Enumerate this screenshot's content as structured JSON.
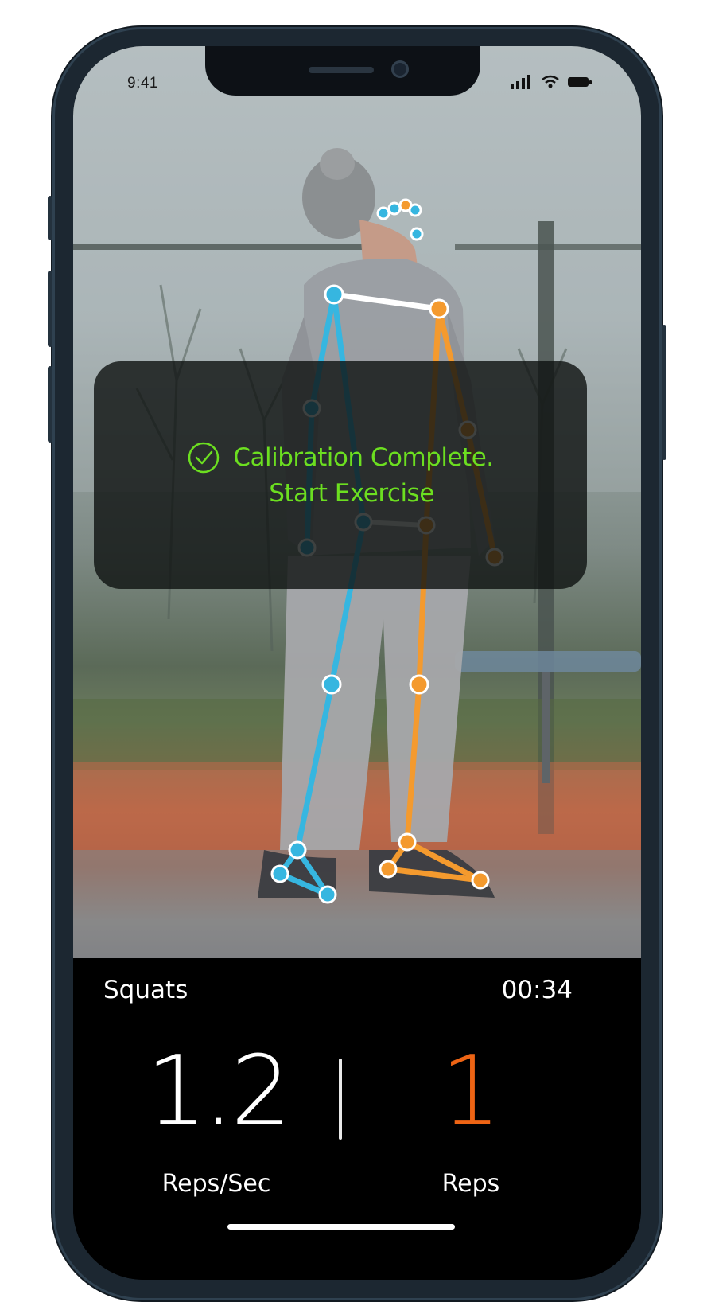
{
  "status_bar": {
    "time": "9:41",
    "icons": [
      "signal-icon",
      "wifi-icon",
      "battery-icon"
    ]
  },
  "overlay": {
    "icon": "check-circle-icon",
    "line1": "Calibration Complete.",
    "line2": "Start Exercise",
    "color": "#6cdf20"
  },
  "camera": {
    "skeleton_colors": {
      "left_side": "#36b6e0",
      "right_side": "#f49a2e",
      "shoulders": "#ffffff"
    }
  },
  "stats": {
    "exercise": "Squats",
    "timer": "00:34",
    "rate_value": "1.2",
    "rate_label": "Reps/Sec",
    "reps_value": "1",
    "reps_label": "Reps",
    "reps_color": "#ee6414"
  }
}
